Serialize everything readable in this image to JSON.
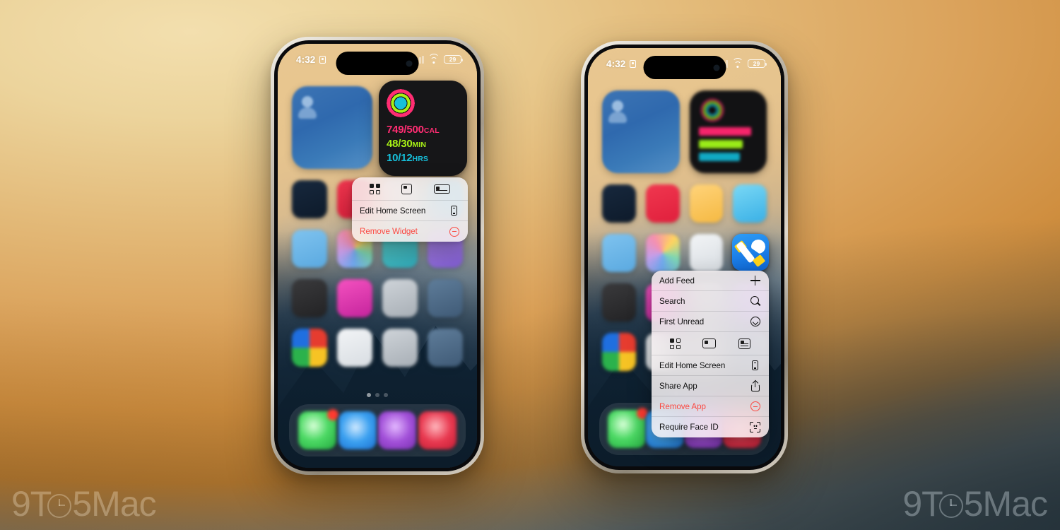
{
  "watermark": {
    "pre": "9T",
    "post": "5Mac",
    "icon": "clock-icon"
  },
  "phones": {
    "left": {
      "statusbar": {
        "time": "4:32",
        "lock_icon": "lock-portrait-icon",
        "signal_icon": "cellular-signal-icon",
        "wifi_icon": "wifi-icon",
        "battery": "29",
        "battery_icon": "battery-icon"
      },
      "fitness_widget": {
        "ring_icon": "activity-rings-icon",
        "move_value": "749/500",
        "move_unit": "CAL",
        "exercise_value": "48/30",
        "exercise_unit": "MIN",
        "stand_value": "10/12",
        "stand_unit": "HRS",
        "colors": {
          "move": "#ff2d72",
          "exercise": "#a8f116",
          "stand": "#16c0db"
        }
      },
      "context_menu": {
        "sizes": [
          {
            "name": "widget-size-small-icon",
            "label": "small"
          },
          {
            "name": "widget-size-medium-icon",
            "label": "medium"
          },
          {
            "name": "widget-size-wide-icon",
            "label": "wide"
          }
        ],
        "items": [
          {
            "label": "Edit Home Screen",
            "icon": "phone-edit-icon",
            "destructive": false
          },
          {
            "label": "Remove Widget",
            "icon": "remove-circle-icon",
            "destructive": true
          }
        ]
      }
    },
    "right": {
      "statusbar": {
        "time": "4:32",
        "lock_icon": "lock-portrait-icon",
        "signal_icon": "cellular-signal-icon",
        "wifi_icon": "wifi-icon",
        "battery": "29",
        "battery_icon": "battery-icon"
      },
      "app_icon": {
        "name": "netnewswire-app-icon"
      },
      "context_menu": {
        "quick_actions": [
          {
            "label": "Add Feed",
            "icon": "plus-icon"
          },
          {
            "label": "Search",
            "icon": "search-icon"
          },
          {
            "label": "First Unread",
            "icon": "chevron-down-circle-icon"
          }
        ],
        "sizes": [
          {
            "name": "widget-size-small-icon",
            "label": "small"
          },
          {
            "name": "widget-size-medium-icon",
            "label": "medium"
          },
          {
            "name": "widget-size-large-icon",
            "label": "large"
          }
        ],
        "items": [
          {
            "label": "Edit Home Screen",
            "icon": "phone-edit-icon",
            "destructive": false
          },
          {
            "label": "Share App",
            "icon": "share-icon",
            "destructive": false
          },
          {
            "label": "Remove App",
            "icon": "remove-circle-icon",
            "destructive": true
          },
          {
            "label": "Require Face ID",
            "icon": "face-id-icon",
            "destructive": false
          }
        ]
      }
    }
  },
  "colors": {
    "destructive": "#fb4a42",
    "menu_background": "rgba(246,240,240,0.86)",
    "app_icon_accent": "#1b7ee8"
  }
}
